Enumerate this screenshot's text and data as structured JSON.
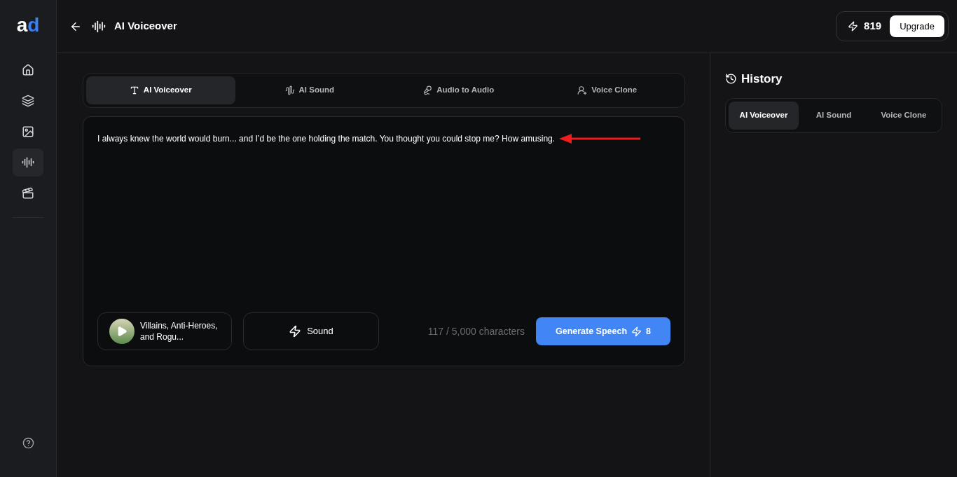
{
  "logo": {
    "first": "a",
    "second": "d"
  },
  "sidebar": {
    "items": [
      {
        "kind": "home",
        "selected": false
      },
      {
        "kind": "layers",
        "selected": false
      },
      {
        "kind": "image",
        "selected": false
      },
      {
        "kind": "voice",
        "selected": true
      },
      {
        "kind": "video",
        "selected": false
      }
    ]
  },
  "header": {
    "title": "AI Voiceover",
    "credits": "819",
    "upgrade": "Upgrade"
  },
  "tabs": [
    {
      "kind": "voiceover",
      "label": "AI Voiceover",
      "selected": true
    },
    {
      "kind": "sound",
      "label": "AI Sound",
      "selected": false
    },
    {
      "kind": "audio",
      "label": "Audio to Audio",
      "selected": false
    },
    {
      "kind": "clone",
      "label": "Voice Clone",
      "selected": false
    }
  ],
  "editor": {
    "text": "I always knew the world would burn... and I’d be the one holding the match. You thought you could stop me? How amusing.",
    "voice": "Villains, Anti-Heroes, and Rogu...",
    "sound": "Sound",
    "count": "117 / 5,000 characters",
    "generate": "Generate Speech",
    "cost": "8"
  },
  "history": {
    "title": "History",
    "tabs": [
      {
        "label": "AI Voiceover",
        "selected": true
      },
      {
        "label": "AI Sound",
        "selected": false
      },
      {
        "label": "Voice Clone",
        "selected": false
      }
    ]
  }
}
